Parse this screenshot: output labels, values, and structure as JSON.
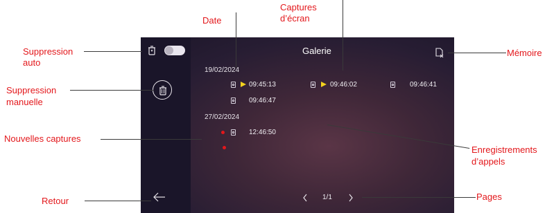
{
  "screen": {
    "title": "Galerie",
    "groups": [
      {
        "date": "19/02/2024",
        "rows": [
          [
            "09:45:13",
            "09:46:02",
            "09:46:41"
          ],
          [
            "09:46:47"
          ]
        ]
      },
      {
        "date": "27/02/2024",
        "rows": [
          [
            "12:46:50"
          ]
        ]
      }
    ],
    "pagination": {
      "page": "1/1"
    }
  },
  "callouts": {
    "date": "Date",
    "captures": "Captures\nd’écran",
    "captures_line1": "Captures",
    "captures_line2": "d’écran",
    "auto_delete_line1": "Suppression",
    "auto_delete_line2": "auto",
    "manual_delete_line1": "Suppression",
    "manual_delete_line2": "manuelle",
    "new_captures": "Nouvelles captures",
    "back": "Retour",
    "memory": "Mémoire",
    "call_recordings_line1": "Enregistrements",
    "call_recordings_line2": "d’appels",
    "pages": "Pages"
  },
  "colors": {
    "accent_red": "#e3171b",
    "play_yellow": "#f3d21e",
    "new_dot_red": "#e3171b"
  },
  "icons": {
    "auto_delete": "trash-clock-icon",
    "manual_delete": "trash-icon",
    "memory": "sd-card-x-icon",
    "back": "arrow-left-icon",
    "prev_page": "chevron-left-icon",
    "next_page": "chevron-right-icon",
    "capture": "screenshot-icon",
    "play": "play-icon",
    "new": "new-dot-icon"
  }
}
